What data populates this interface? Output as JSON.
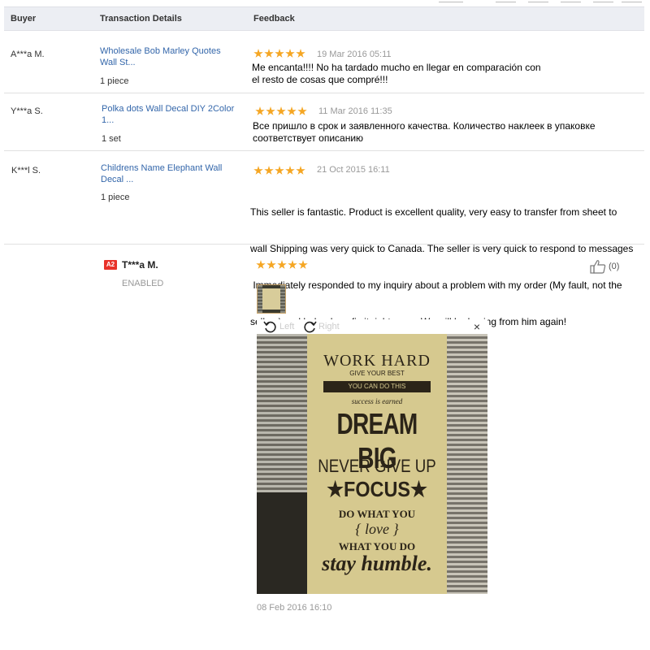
{
  "header": {
    "col_buyer": "Buyer",
    "col_transaction": "Transaction Details",
    "col_feedback": "Feedback"
  },
  "rows": [
    {
      "buyer": "A***a M.",
      "product": "Wholesale Bob Marley Quotes Wall St...",
      "quantity": "1 piece",
      "rating": 5,
      "date": "19 Mar 2016 05:11",
      "feedback_lines": [
        "Me encanta!!!! No ha tardado mucho en llegar en comparación con",
        "el resto de cosas que compré!!!"
      ]
    },
    {
      "buyer": "Y***a S.",
      "product": "Polka dots Wall Decal DIY 2Color 1...",
      "quantity": "1 set",
      "rating": 5,
      "date": "11 Mar 2016 11:35",
      "feedback_lines": [
        "Все пришло в срок и заявленного качества. Количество наклеек в упаковке",
        "соответствует описанию"
      ]
    },
    {
      "buyer": "K***l S.",
      "product": "Childrens Name Elephant Wall Decal ...",
      "quantity": "1 piece",
      "rating": 5,
      "date": "21 Oct 2015 16:11",
      "feedback_lines": [
        "This seller is fantastic. Product is excellent quality, very easy to transfer from sheet to",
        "wall Shipping was very quick to Canada. The seller is very quick to respond to messages",
        " Immediately responded to my inquiry about a problem with my order (My fault, not the",
        "sellers) and helped me fix it right away. We will be buying from him again!"
      ]
    }
  ],
  "review": {
    "badge": "A2",
    "name": "T***a M.",
    "status": "ENABLED",
    "rating": 5,
    "helpful_count": "(0)",
    "rotate_left": "Left",
    "rotate_right": "Right",
    "close": "×",
    "date": "08 Feb 2016 16:10",
    "poster": {
      "line1": "WORK HARD",
      "line2": "GIVE YOUR BEST",
      "line3": "YOU CAN DO THIS",
      "line4": "success is earned",
      "line5": "DREAM BIG",
      "line6": "NEVER GIVE UP",
      "line7": "★FOCUS★",
      "line8": "DO WHAT YOU",
      "line9": "{ love }",
      "line10": "WHAT YOU DO",
      "line11": "stay humble."
    }
  },
  "colors": {
    "star": "#f5a623",
    "link": "#3366aa",
    "badge": "#e8322a",
    "header_bg": "#eceef3"
  }
}
